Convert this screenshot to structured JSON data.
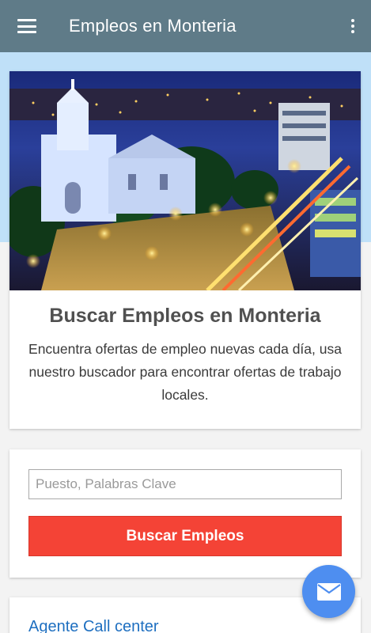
{
  "appbar": {
    "title": "Empleos en Monteria",
    "menu_icon": "hamburger-menu-icon",
    "overflow_icon": "more-vert-icon",
    "color": "#5f7b88"
  },
  "hero": {
    "image_icon": "city-night-photo",
    "title": "Buscar Empleos en Monteria",
    "description": "Encuentra ofertas de empleo nuevas cada día, usa nuestro buscador para encontrar ofertas de trabajo locales."
  },
  "search": {
    "placeholder": "Puesto, Palabras Clave",
    "value": "",
    "button_label": "Buscar Empleos",
    "button_color": "#f44336"
  },
  "jobs": [
    {
      "title": "Agente Call center"
    }
  ],
  "fab": {
    "icon": "email-icon",
    "color": "#4e8ef0"
  }
}
